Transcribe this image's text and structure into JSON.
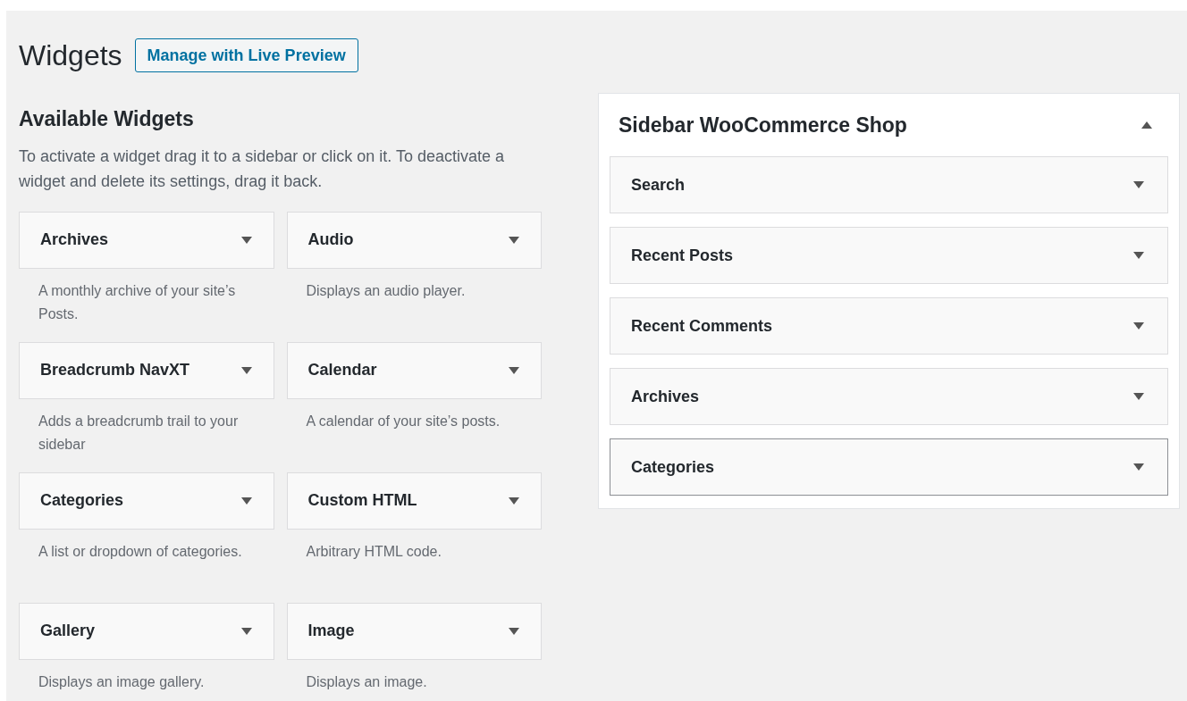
{
  "page_title": "Widgets",
  "header_button": "Manage with Live Preview",
  "available": {
    "heading": "Available Widgets",
    "description": "To activate a widget drag it to a sidebar or click on it. To deactivate a widget and delete its settings, drag it back.",
    "widgets": [
      {
        "title": "Archives",
        "description": "A monthly archive of your site’s Posts."
      },
      {
        "title": "Audio",
        "description": "Displays an audio player."
      },
      {
        "title": "Breadcrumb NavXT",
        "description": "Adds a breadcrumb trail to your sidebar"
      },
      {
        "title": "Calendar",
        "description": "A calendar of your site’s posts."
      },
      {
        "title": "Categories",
        "description": "A list or dropdown of categories."
      },
      {
        "title": "Custom HTML",
        "description": "Arbitrary HTML code."
      },
      {
        "title": "Gallery",
        "description": "Displays an image gallery."
      },
      {
        "title": "Image",
        "description": "Displays an image."
      }
    ]
  },
  "sidebar": {
    "title": "Sidebar WooCommerce Shop",
    "expanded": true,
    "widgets": [
      {
        "title": "Search",
        "selected": false
      },
      {
        "title": "Recent Posts",
        "selected": false
      },
      {
        "title": "Recent Comments",
        "selected": false
      },
      {
        "title": "Archives",
        "selected": false
      },
      {
        "title": "Categories",
        "selected": true
      }
    ]
  }
}
